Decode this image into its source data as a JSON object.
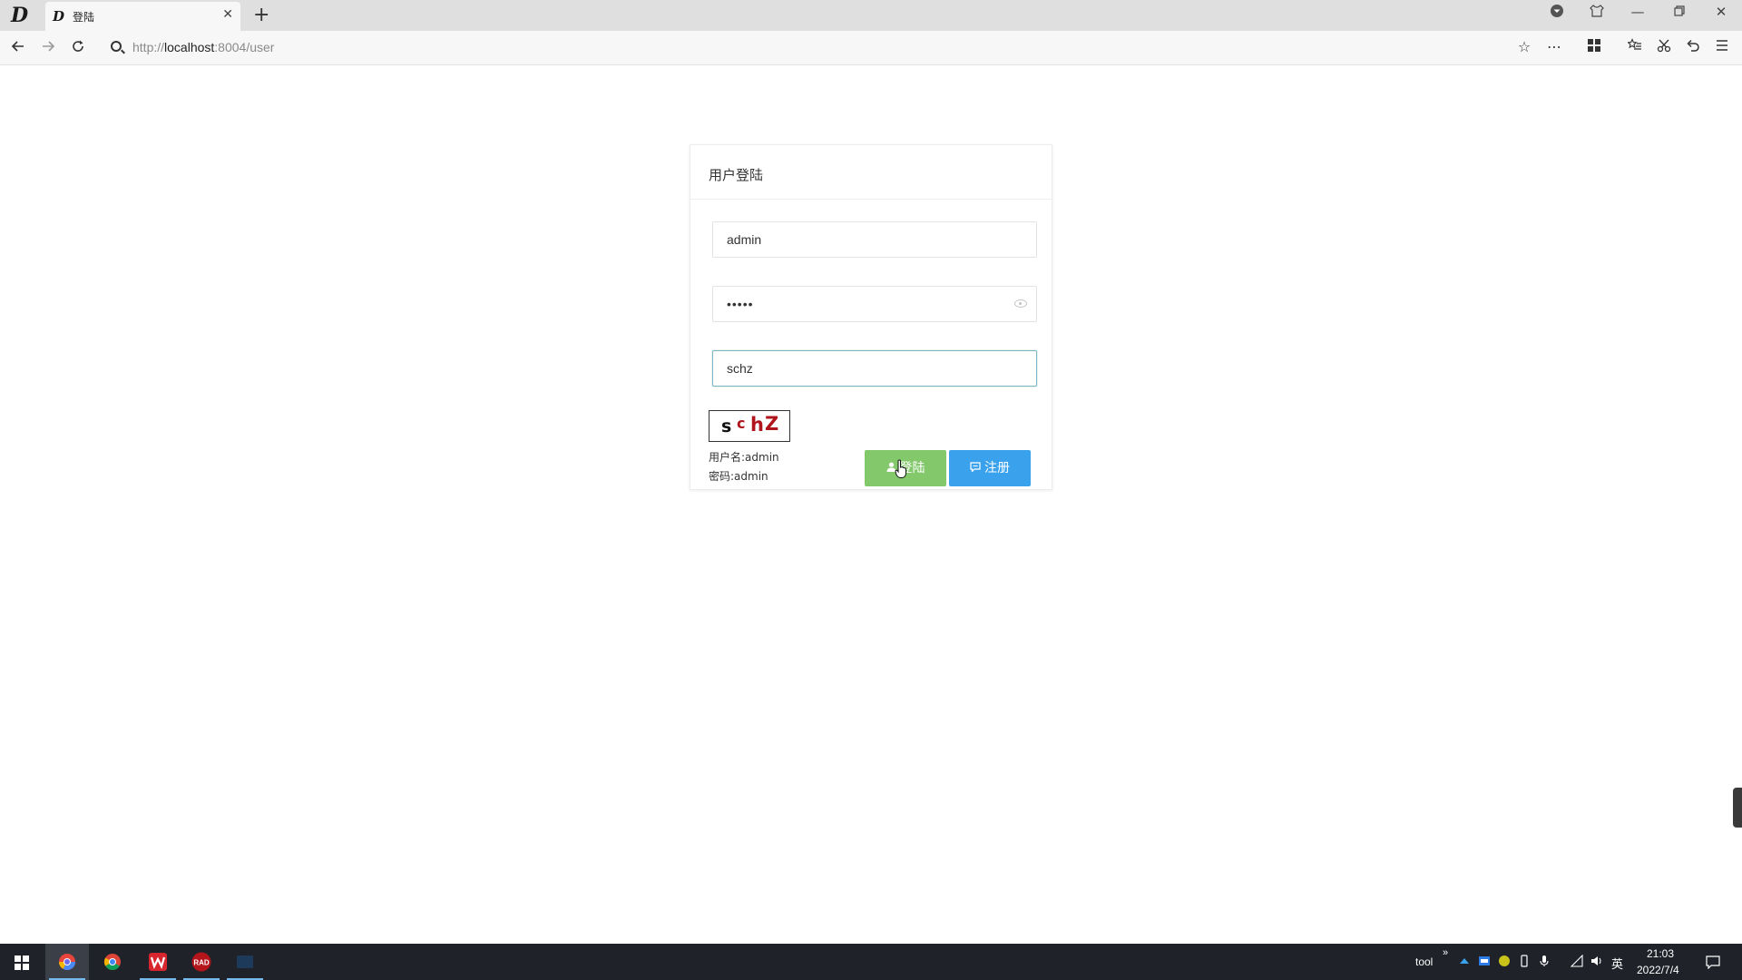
{
  "browser": {
    "tab_title": "登陆",
    "url_prefix": "http://",
    "url_host": "localhost",
    "url_rest": ":8004/user"
  },
  "login": {
    "header": "用户登陆",
    "username_value": "admin",
    "password_value": "•••••",
    "captcha_input_value": "schz",
    "captcha_chars": [
      "s",
      "c",
      "h",
      "Z"
    ],
    "hint_username": "用户名:admin",
    "hint_password": "密码:admin",
    "login_button": "登陆",
    "register_button": "注册"
  },
  "colors": {
    "login_button": "#83c96c",
    "register_button": "#3aa2ec",
    "captcha_red": "#b0151b",
    "captcha_dark": "#111111"
  },
  "taskbar": {
    "tray_label": "tool",
    "ime": "英",
    "time": "21:03",
    "date": "2022/7/4"
  }
}
